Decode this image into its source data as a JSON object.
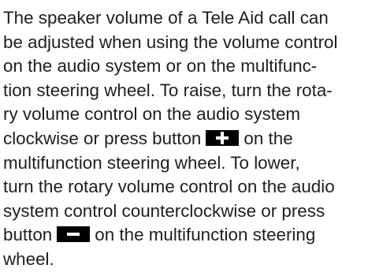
{
  "paragraph": {
    "lines": [
      "The speaker volume of a Tele Aid call can",
      "be adjusted when using the volume control",
      "on the audio system or on the multifunc-",
      "tion steering wheel. To raise, turn the rota-",
      "ry volume control on the audio system",
      "multifunction steering wheel. To lower,",
      "turn the rotary volume control on the audio",
      "system control counterclockwise or press",
      "wheel."
    ],
    "line6_before": "clockwise or press button",
    "line6_after": "on the",
    "line10_before": "button",
    "line10_after": "on the multifunction steering"
  },
  "icons": {
    "plus_button": "plus-button-icon",
    "minus_button": "minus-button-icon"
  }
}
